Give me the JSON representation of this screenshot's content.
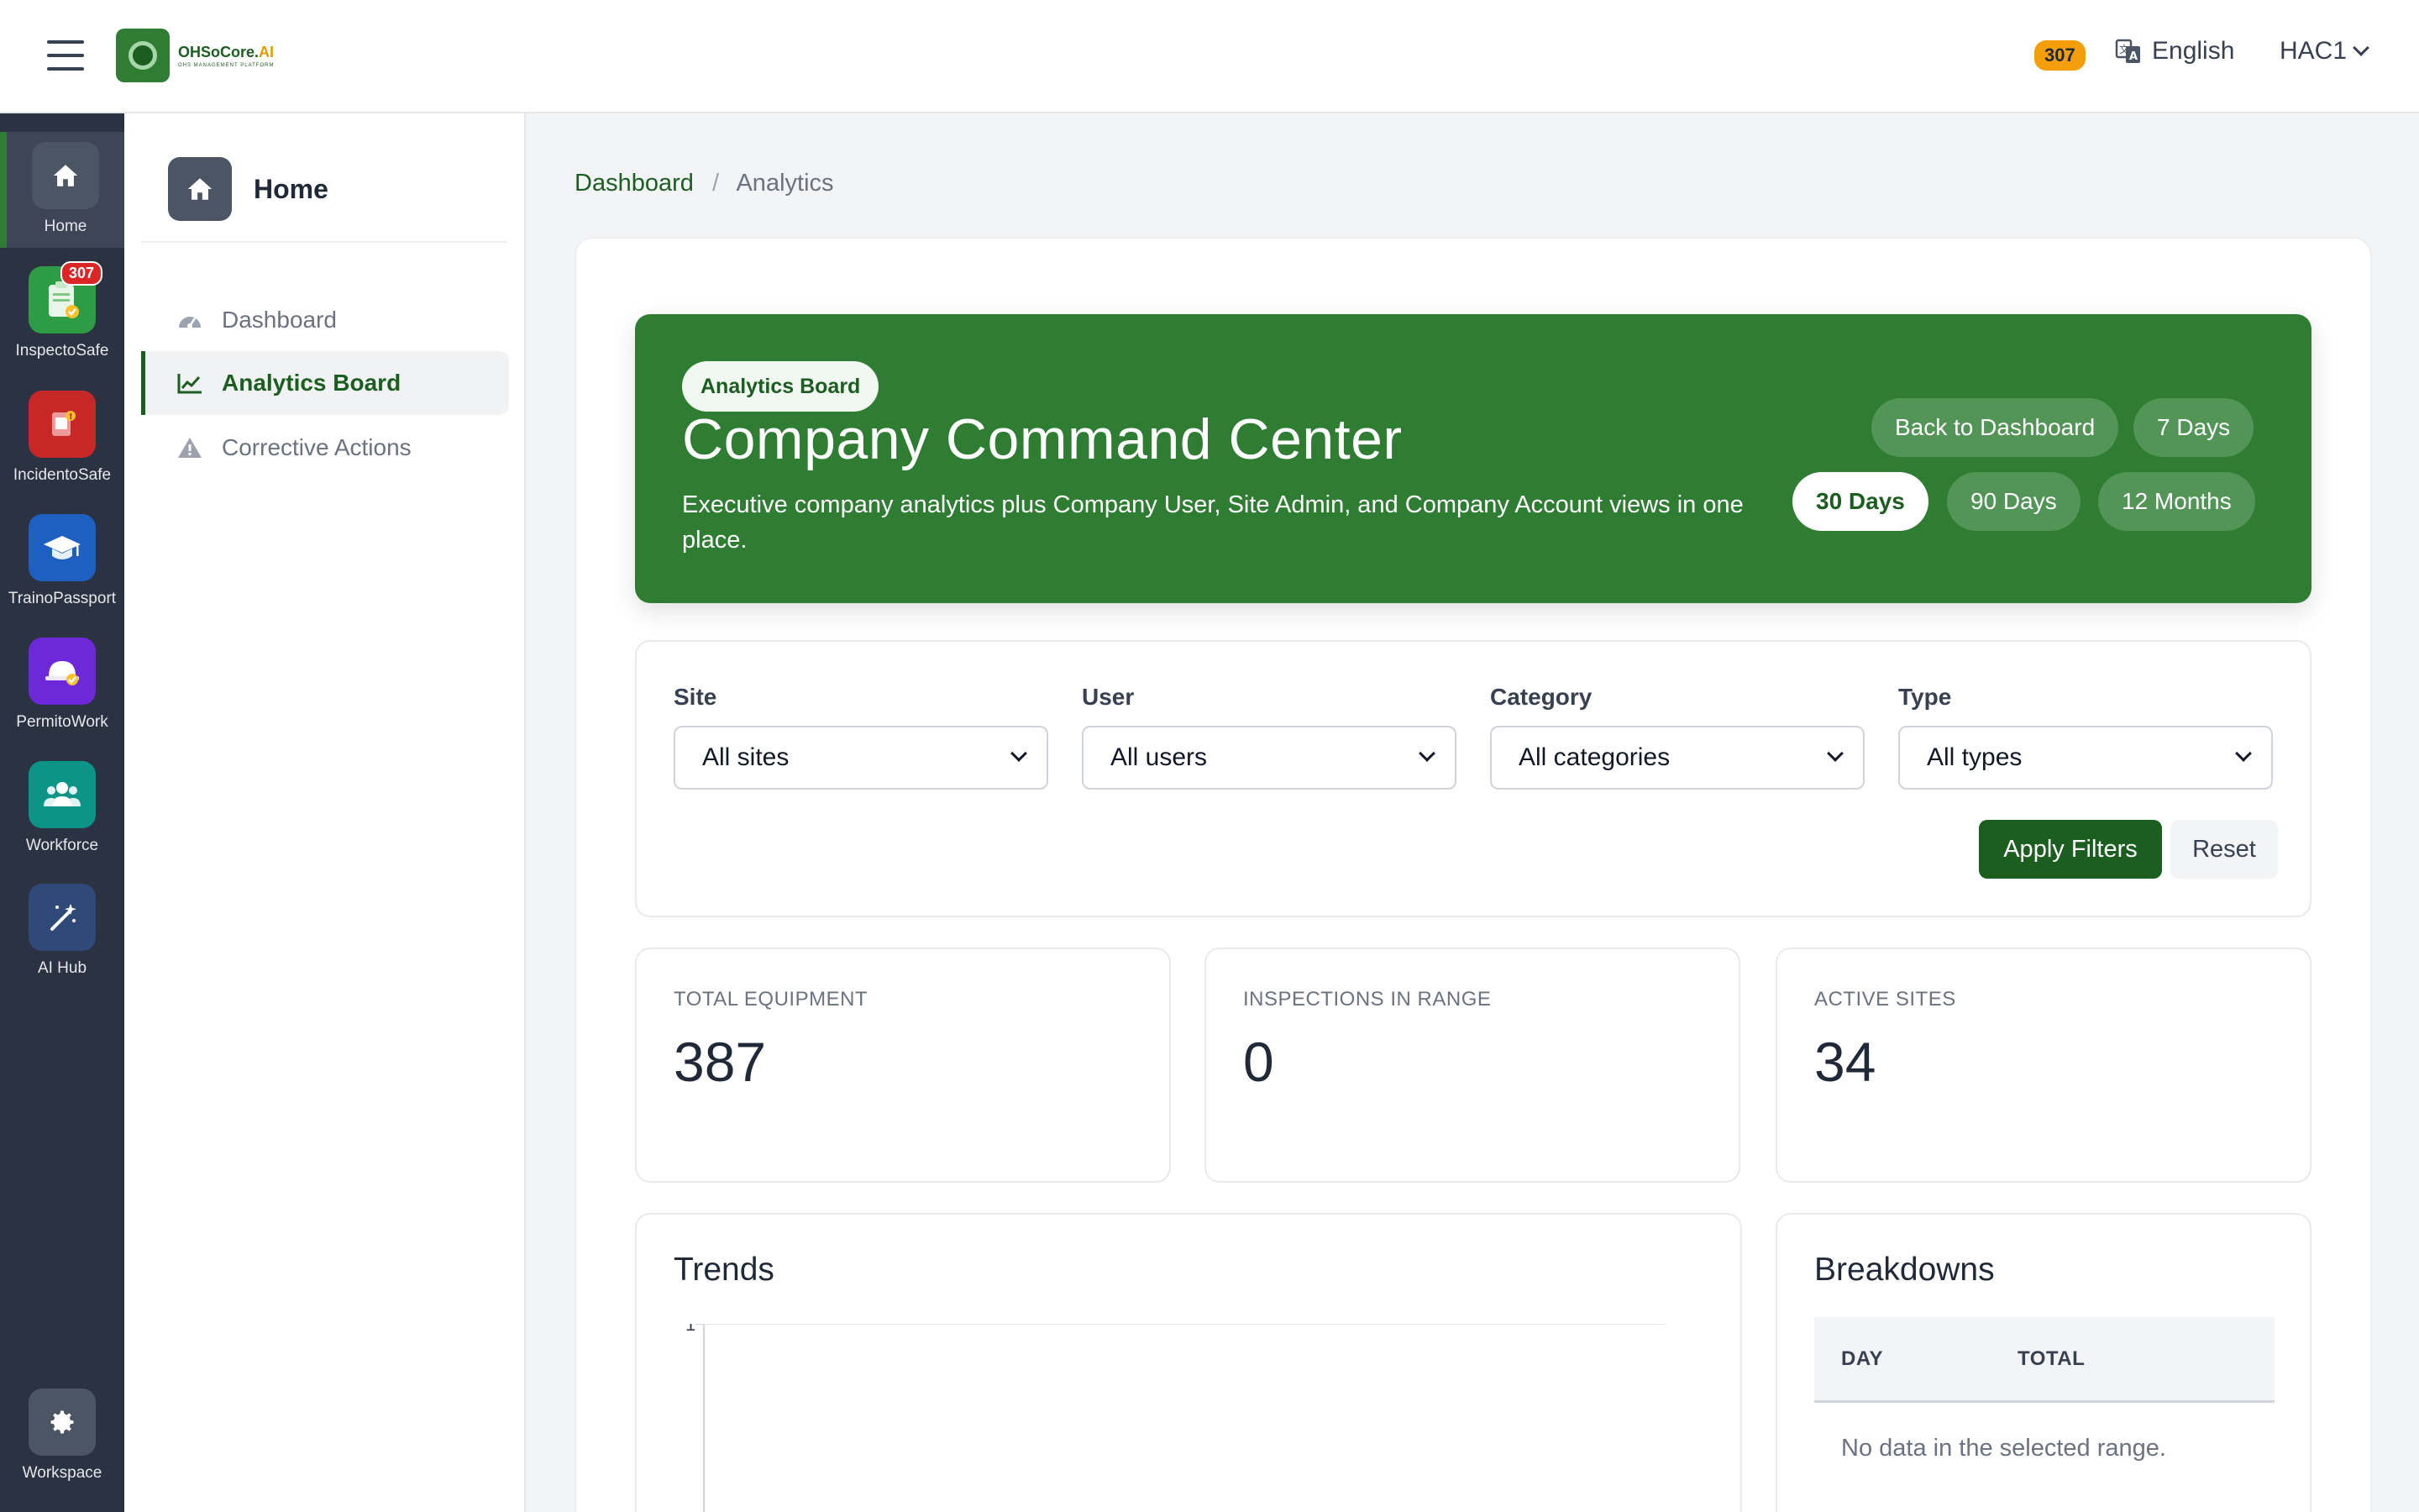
{
  "header": {
    "brand_main": "OHSoCore.",
    "brand_ai": "AI",
    "brand_sub": "OHS MANAGEMENT PLATFORM",
    "notification_count": "307",
    "language": "English",
    "account": "HAC1"
  },
  "rail": {
    "items": [
      {
        "label": "Home",
        "icon": "home-icon",
        "color": "#4b5563",
        "badge": ""
      },
      {
        "label": "InspectoSafe",
        "icon": "clipboard-check-icon",
        "color": "#2e9b45",
        "badge": "307"
      },
      {
        "label": "IncidentoSafe",
        "icon": "incident-icon",
        "color": "#c62828",
        "badge": ""
      },
      {
        "label": "TrainoPassport",
        "icon": "graduation-cap-icon",
        "color": "#1e5fc2",
        "badge": ""
      },
      {
        "label": "PermitoWork",
        "icon": "hard-hat-icon",
        "color": "#6d28d9",
        "badge": ""
      },
      {
        "label": "Workforce",
        "icon": "users-icon",
        "color": "#0d9488",
        "badge": ""
      },
      {
        "label": "AI Hub",
        "icon": "magic-wand-icon",
        "color": "#2f4a78",
        "badge": ""
      }
    ],
    "workspace": {
      "label": "Workspace",
      "icon": "gear-icon"
    }
  },
  "subnav": {
    "title": "Home",
    "items": [
      {
        "label": "Dashboard",
        "icon": "dashboard-gauge-icon"
      },
      {
        "label": "Analytics Board",
        "icon": "line-chart-icon"
      },
      {
        "label": "Corrective Actions",
        "icon": "warning-triangle-icon"
      }
    ]
  },
  "breadcrumb": {
    "root": "Dashboard",
    "sep": "/",
    "current": "Analytics"
  },
  "hero": {
    "pill": "Analytics Board",
    "title": "Company Command Center",
    "description": "Executive company analytics plus Company User, Site Admin, and Company Account views in one place.",
    "back_button": "Back to Dashboard",
    "ranges": [
      "7 Days",
      "30 Days",
      "90 Days",
      "12 Months"
    ],
    "selected_range": "30 Days"
  },
  "filters": {
    "site": {
      "label": "Site",
      "value": "All sites"
    },
    "user": {
      "label": "User",
      "value": "All users"
    },
    "category": {
      "label": "Category",
      "value": "All categories"
    },
    "type": {
      "label": "Type",
      "value": "All types"
    },
    "apply": "Apply Filters",
    "reset": "Reset"
  },
  "stats": [
    {
      "label": "TOTAL EQUIPMENT",
      "value": "387"
    },
    {
      "label": "INSPECTIONS IN RANGE",
      "value": "0"
    },
    {
      "label": "ACTIVE SITES",
      "value": "34"
    }
  ],
  "trends": {
    "title": "Trends"
  },
  "chart_data": {
    "type": "line",
    "title": "Trends",
    "y_ticks": [
      "1"
    ],
    "series": []
  },
  "breakdowns": {
    "title": "Breakdowns",
    "columns": [
      "DAY",
      "TOTAL"
    ],
    "empty_text": "No data in the selected range."
  }
}
